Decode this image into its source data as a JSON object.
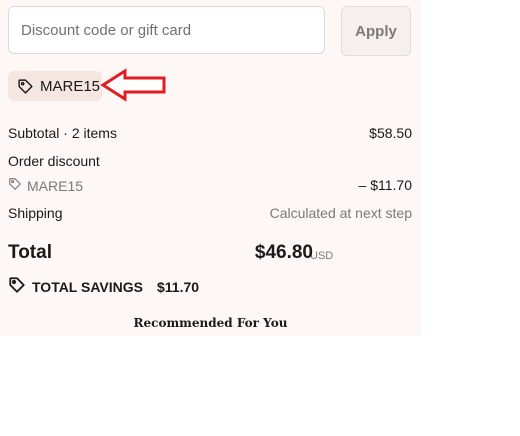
{
  "discount": {
    "placeholder": "Discount code or gift card",
    "apply_label": "Apply",
    "applied_code": "MARE15"
  },
  "summary": {
    "subtotal_label": "Subtotal · 2 items",
    "subtotal_value": "$58.50",
    "order_discount_label": "Order discount",
    "discount_code": "MARE15",
    "discount_value": "– $11.70",
    "shipping_label": "Shipping",
    "shipping_value": "Calculated at next step"
  },
  "total": {
    "label": "Total",
    "currency": "USD",
    "amount": "$46.80"
  },
  "savings": {
    "label": "TOTAL SAVINGS",
    "amount": "$11.70"
  },
  "recommended_heading": "Recommended For You",
  "colors": {
    "panel_bg": "#fdf7f5",
    "chip_bg": "#f5e6e2",
    "arrow": "#e31b23"
  },
  "icons": {
    "tag": "tag-icon",
    "arrow": "red-arrow-icon"
  }
}
